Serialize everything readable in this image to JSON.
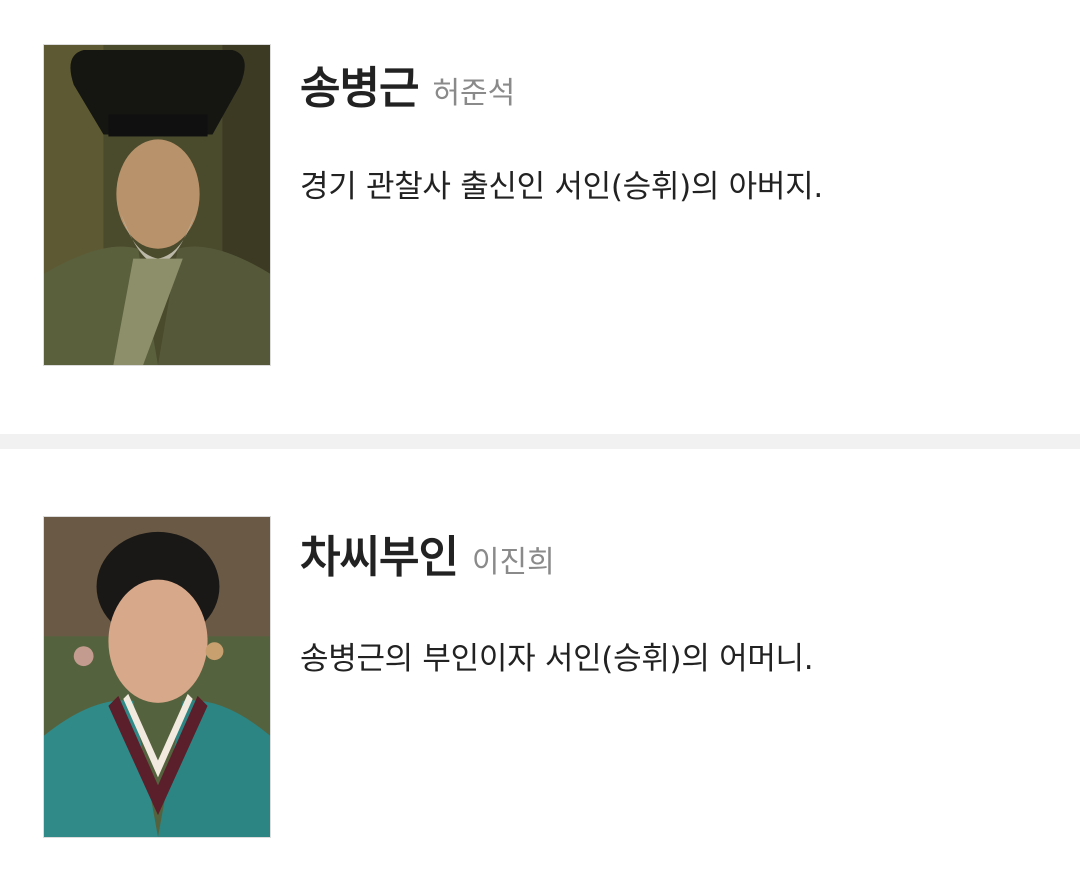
{
  "characters": [
    {
      "name": "송병근",
      "actor": "허준석",
      "description": "경기 관찰사 출신인 서인(승휘)의 아버지.",
      "photo": "portrait-man-black-gat-beard-green-robe"
    },
    {
      "name": "차씨부인",
      "actor": "이진희",
      "description": "송병근의 부인이자 서인(승휘)의 어머니.",
      "photo": "portrait-woman-hanbok-teal-dark-collar"
    }
  ],
  "colors": {
    "background": "#ffffff",
    "divider": "#f1f1f1",
    "name_text": "#222222",
    "actor_text": "#8a8a8a"
  }
}
